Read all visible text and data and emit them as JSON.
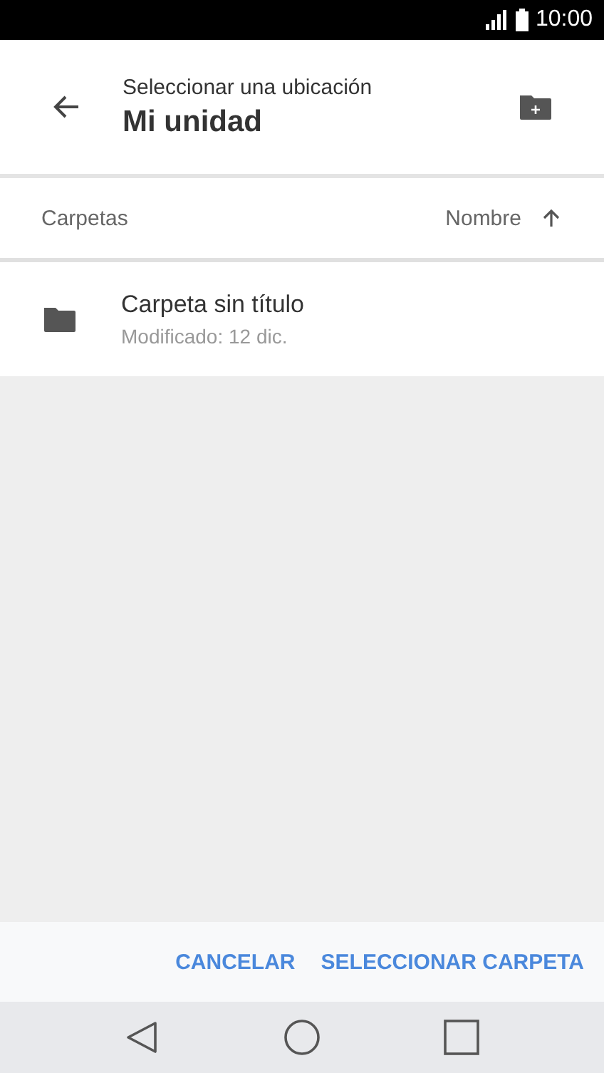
{
  "status_bar": {
    "time": "10:00"
  },
  "header": {
    "subtitle": "Seleccionar una ubicación",
    "title": "Mi unidad"
  },
  "list_header": {
    "label": "Carpetas",
    "sort": "Nombre"
  },
  "folders": [
    {
      "name": "Carpeta sin título",
      "modified": "Modificado: 12 dic."
    }
  ],
  "buttons": [
    "CANCELAR",
    "SELECCIONAR CARPETA"
  ]
}
